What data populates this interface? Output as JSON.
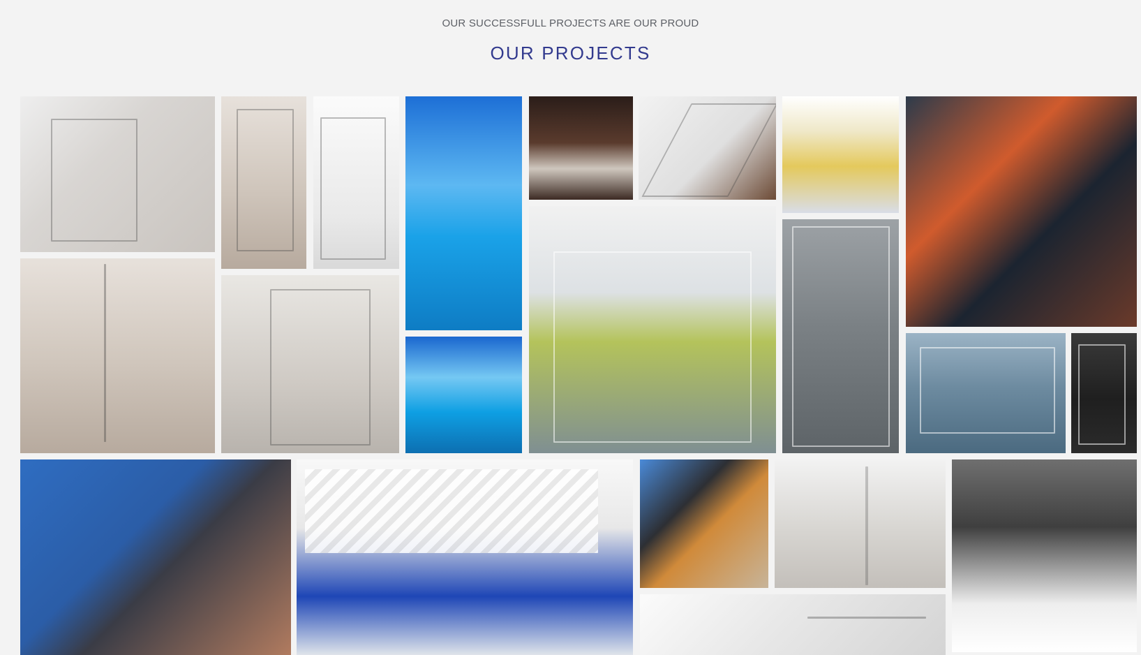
{
  "header": {
    "subtitle": "OUR SUCCESSFULL PROJECTS ARE OUR PROUD",
    "title": "OUR PROJECTS"
  },
  "gallery": {
    "items": [
      {
        "name": "project-photo-glass-shower-1",
        "palette": "p-bath-light"
      },
      {
        "name": "project-photo-glass-shower-2",
        "palette": "p-bath-warm"
      },
      {
        "name": "project-photo-glass-shower-3",
        "palette": "p-shower"
      },
      {
        "name": "project-photo-glass-shower-4",
        "palette": "p-shower-white"
      },
      {
        "name": "project-photo-pool-1",
        "palette": "p-pool"
      },
      {
        "name": "project-photo-pool-2",
        "palette": "p-pool2"
      },
      {
        "name": "project-photo-kitchen",
        "palette": "p-kitchen"
      },
      {
        "name": "project-photo-glass-stairs",
        "palette": "p-stairs"
      },
      {
        "name": "project-photo-painting-wall",
        "palette": "p-wall"
      },
      {
        "name": "project-photo-welding-1",
        "palette": "p-welder"
      },
      {
        "name": "project-photo-office-glass",
        "palette": "p-office"
      },
      {
        "name": "project-photo-glass-door",
        "palette": "p-glass-door"
      },
      {
        "name": "project-photo-glass-facade",
        "palette": "p-facade"
      },
      {
        "name": "project-photo-dark-glass",
        "palette": "p-dark-glass"
      },
      {
        "name": "project-photo-welding-2",
        "palette": "p-welder-blue"
      },
      {
        "name": "project-photo-pergola",
        "palette": "p-pergola"
      },
      {
        "name": "project-photo-installation",
        "palette": "p-worker"
      },
      {
        "name": "project-photo-bathroom-1",
        "palette": "p-bathroom2"
      },
      {
        "name": "project-photo-bathroom-2",
        "palette": "p-bathroom3"
      },
      {
        "name": "project-photo-marble",
        "palette": "p-marble"
      }
    ]
  }
}
